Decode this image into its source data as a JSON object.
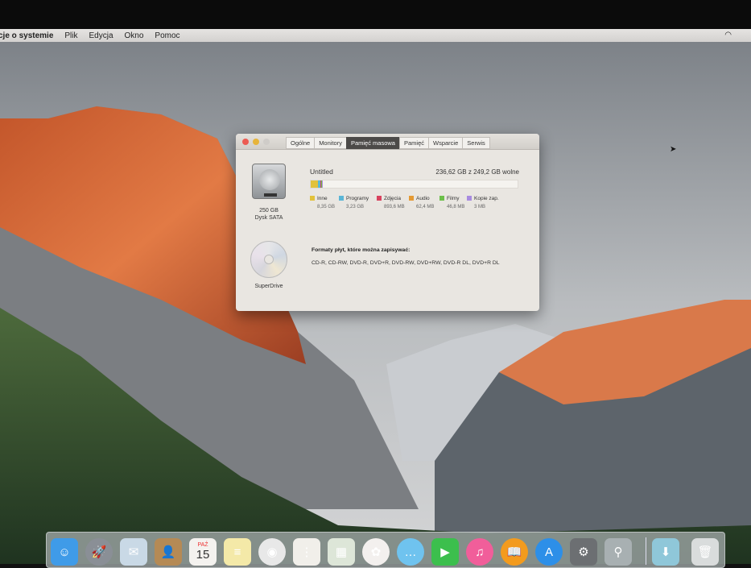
{
  "menubar": {
    "app": "cje o systemie",
    "items": [
      "Plik",
      "Edycja",
      "Okno",
      "Pomoc"
    ]
  },
  "window": {
    "tabs": [
      "Ogólne",
      "Monitory",
      "Pamięć masowa",
      "Pamięć",
      "Wsparcie",
      "Serwis"
    ],
    "active_tab": "Pamięć masowa",
    "disk": {
      "size": "250 GB",
      "type": "Dysk SATA",
      "volume": "Untitled",
      "free": "236,62 GB z 249,2 GB wolne",
      "categories": [
        {
          "name": "Inne",
          "size": "8,35 GB",
          "color": "#e2c23b",
          "gb": 8.35
        },
        {
          "name": "Programy",
          "size": "3,23 GB",
          "color": "#5bb6d6",
          "gb": 3.23
        },
        {
          "name": "Zdjęcia",
          "size": "893,6 MB",
          "color": "#d8425e",
          "gb": 0.89
        },
        {
          "name": "Audio",
          "size": "62,4 MB",
          "color": "#e49a34",
          "gb": 0.06
        },
        {
          "name": "Filmy",
          "size": "46,8 MB",
          "color": "#6cc04a",
          "gb": 0.05
        },
        {
          "name": "Kopie zap.",
          "size": "3 MB",
          "color": "#a88be0",
          "gb": 0.003
        }
      ],
      "total_gb": 249.2
    },
    "drive": {
      "name": "SuperDrive",
      "formats_label": "Formaty płyt, które można zapisywać:",
      "formats": "CD-R, CD-RW, DVD-R, DVD+R, DVD-RW, DVD+RW, DVD-R DL, DVD+R DL"
    }
  },
  "dock": {
    "calendar_month": "PAŹ",
    "calendar_day": "15",
    "apps": [
      {
        "name": "finder",
        "color": "#3f9be8",
        "glyph": "☺"
      },
      {
        "name": "launchpad",
        "color": "#8a8f96",
        "glyph": "🚀"
      },
      {
        "name": "mail",
        "color": "#c9d9e6",
        "glyph": "✉"
      },
      {
        "name": "contacts",
        "color": "#b58a55",
        "glyph": "👤"
      },
      {
        "name": "calendar",
        "color": "#f4f2ef",
        "glyph": ""
      },
      {
        "name": "notes",
        "color": "#f4e9a8",
        "glyph": "≡"
      },
      {
        "name": "chrome",
        "color": "#e8e8e8",
        "glyph": "◉"
      },
      {
        "name": "reminders",
        "color": "#f1efea",
        "glyph": "⋮"
      },
      {
        "name": "preview",
        "color": "#dde6d8",
        "glyph": "▦"
      },
      {
        "name": "photos",
        "color": "#f3f0ee",
        "glyph": "✿"
      },
      {
        "name": "messages",
        "color": "#6fc3ef",
        "glyph": "…"
      },
      {
        "name": "facetime",
        "color": "#3cbf4d",
        "glyph": "▶"
      },
      {
        "name": "itunes",
        "color": "#f15e9a",
        "glyph": "♫"
      },
      {
        "name": "ibooks",
        "color": "#f39b1e",
        "glyph": "📖"
      },
      {
        "name": "app-store",
        "color": "#2d8fe8",
        "glyph": "A"
      },
      {
        "name": "system-preferences",
        "color": "#6c6f72",
        "glyph": "⚙"
      },
      {
        "name": "utility",
        "color": "#a8b0b2",
        "glyph": "⚲"
      },
      {
        "name": "downloads",
        "color": "#8fc7d9",
        "glyph": "⬇"
      },
      {
        "name": "trash",
        "color": "#d9dcdc",
        "glyph": "🗑"
      }
    ]
  }
}
